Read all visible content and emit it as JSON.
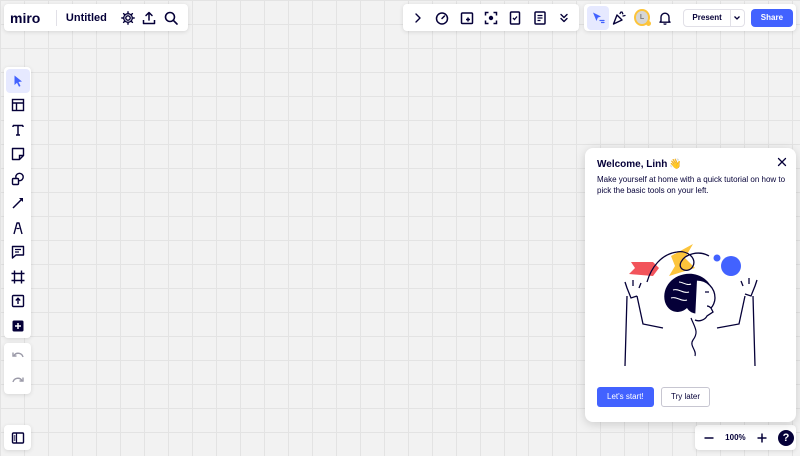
{
  "app": {
    "logo_text": "miro",
    "board_title": "Untitled"
  },
  "top_right": {
    "avatar_initial": "L",
    "present_label": "Present",
    "share_label": "Share"
  },
  "zoom": {
    "level": "100%"
  },
  "help": {
    "label": "?"
  },
  "welcome": {
    "title": "Welcome, Linh",
    "emoji": "👋",
    "description": "Make yourself at home with a quick tutorial on how to pick the basic tools on your left.",
    "start_label": "Let's start!",
    "later_label": "Try later"
  },
  "colors": {
    "accent": "#4262ff",
    "ink": "#050038",
    "illustration_yellow": "#fcc43b",
    "illustration_red": "#f2545b",
    "illustration_blue": "#4262ff"
  },
  "icons": {
    "board_bar": [
      "settings-icon",
      "upload-icon",
      "search-icon"
    ],
    "collab_bar": [
      "chevron-right-icon",
      "timer-icon",
      "sticky-note-add-icon",
      "focus-icon",
      "voting-icon",
      "notes-icon",
      "chevrons-down-icon"
    ],
    "tools": [
      "select-icon",
      "templates-icon",
      "text-icon",
      "sticky-note-icon",
      "shapes-icon",
      "line-icon",
      "pen-icon",
      "comment-icon",
      "frame-icon",
      "upload-icon",
      "more-apps-icon"
    ],
    "history": [
      "undo-icon",
      "redo-icon"
    ]
  }
}
